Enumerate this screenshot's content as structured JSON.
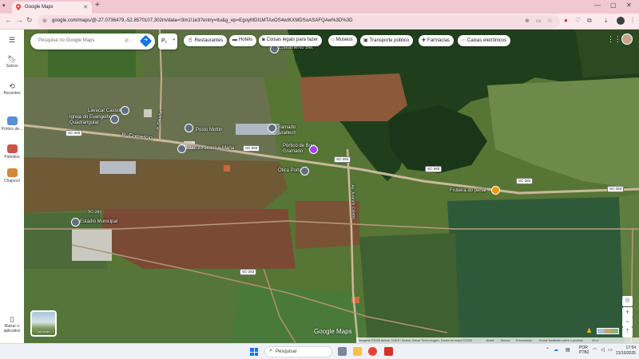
{
  "browser": {
    "tab_title": "Google Maps",
    "new_tab_symbol": "+",
    "url": "google.com/maps/@-27.0736479,-52.8570107,302m/data=!3m1!1e3?entry=ttu&g_ep=EgoyMDI1MTAxOS4wIKXMDSoASAFQAw%3D%3D",
    "icons": [
      "back-icon",
      "forward-icon",
      "reload-icon",
      "site-info-icon",
      "star-icon",
      "extension-icon",
      "download-icon",
      "menu-icon"
    ]
  },
  "rail": {
    "items": [
      {
        "label": "Salvos",
        "icon": "bookmark-icon"
      },
      {
        "label": "Recentes",
        "icon": "history-icon"
      },
      {
        "label": "Pórtico de...",
        "icon": "place-thumb"
      },
      {
        "label": "Palmitos",
        "icon": "place-thumb"
      },
      {
        "label": "Chapecó",
        "icon": "place-thumb"
      }
    ],
    "download_label": "Baixar o aplicativo"
  },
  "search": {
    "placeholder": "Pesquise no Google Maps",
    "preview_label": "P₂"
  },
  "chips": [
    {
      "label": "Restaurantes",
      "icon": "fork-knife-icon"
    },
    {
      "label": "Hotéis",
      "icon": "bed-icon"
    },
    {
      "label": "Coisas legais para fazer",
      "icon": "camera-icon"
    },
    {
      "label": "Museus",
      "icon": "museum-icon"
    },
    {
      "label": "Transporte público",
      "icon": "bus-icon"
    },
    {
      "label": "Farmácias",
      "icon": "pharmacy-icon"
    },
    {
      "label": "Caixas eletrônicos",
      "icon": "atm-icon"
    }
  ],
  "map": {
    "place_labels": [
      "Loteamento Bet",
      "Lavacar Cassol",
      "Igreja do Evangelho Quadrangular",
      "Posto Mottin",
      "Gramado Ruraltech",
      "Pórtico de Bom Gramado",
      "Instituto Jesus e Maria",
      "Ótica Porto",
      "Fruteira do penal",
      "Estádio Municipal"
    ],
    "road_labels": [
      "R. Comercio",
      "R. Gaúcha",
      "Av. Jurandir Colatto",
      "SC-283"
    ],
    "shields": [
      "SC-283",
      "SC-283",
      "SC-283",
      "SC-283",
      "SC-283",
      "SC-283",
      "SC-283"
    ],
    "layers_label": "Camadas",
    "logo": "Google Maps",
    "attribution": "Imagens ©2025 Airbus, CNES / Airbus, Maxar Technologies, Dados do mapa ©2025",
    "attribution_links": [
      "Brasil",
      "Termos",
      "Privacidade",
      "Enviar feedback sobre o produto",
      "20 m"
    ]
  },
  "taskbar": {
    "search_placeholder": "Pesquisar",
    "language": "POR",
    "layout": "PTB2",
    "time": "17:54",
    "date": "21/10/2025"
  }
}
